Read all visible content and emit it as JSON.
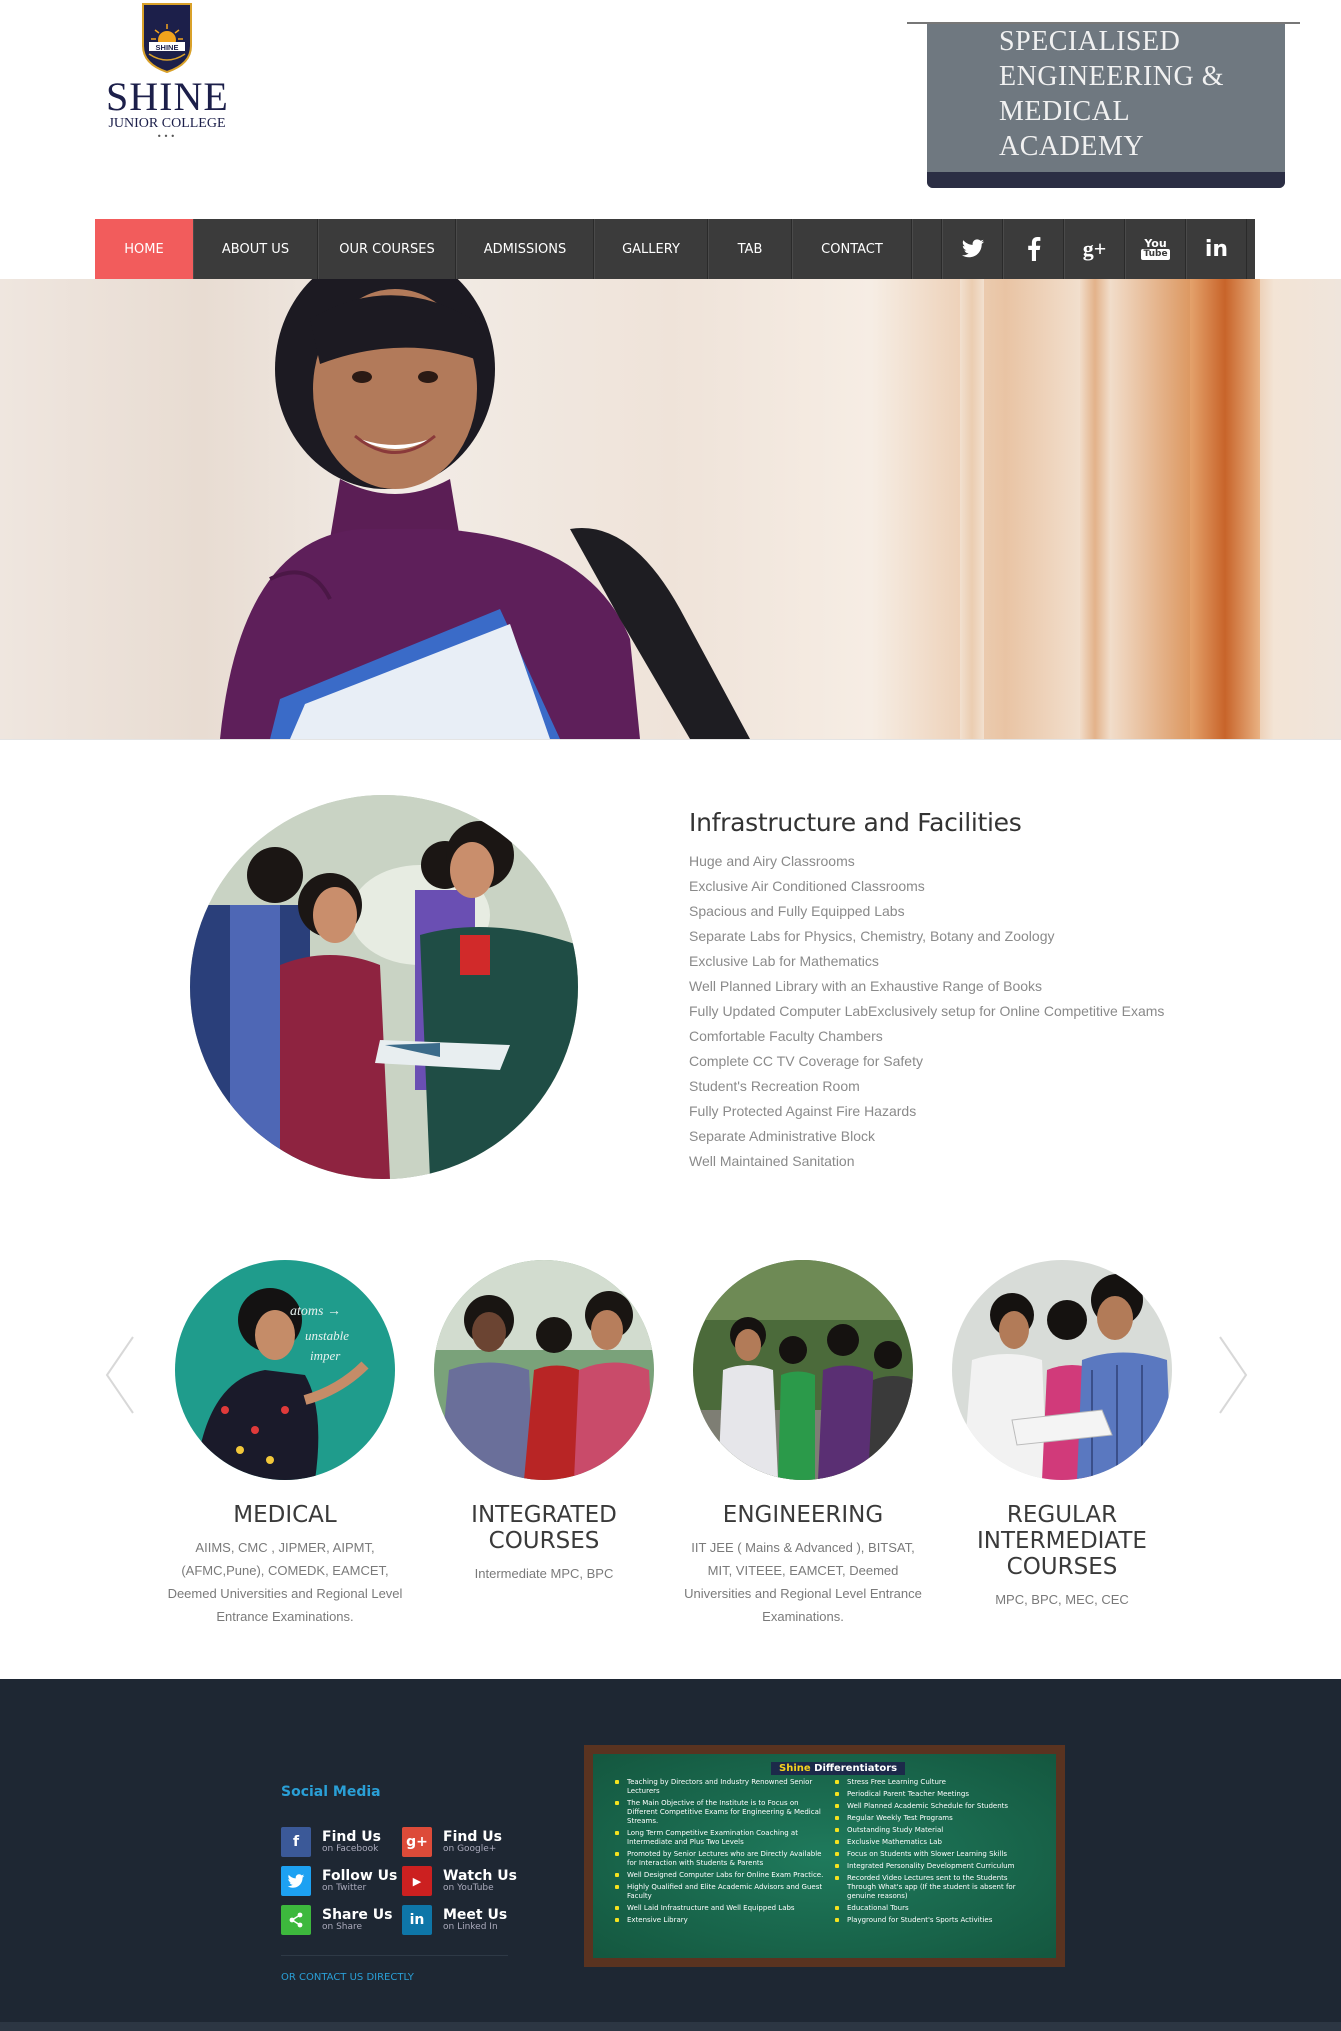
{
  "header": {
    "logo_emblem_text": "SHINE",
    "logo_title": "SHINE",
    "logo_subtitle": "JUNIOR COLLEGE",
    "logo_dots": "•••",
    "banner_lines": [
      "SPECIALISED",
      "ENGINEERING &",
      "MEDICAL",
      "ACADEMY"
    ]
  },
  "nav": {
    "items": [
      {
        "label": "HOME",
        "active": true
      },
      {
        "label": "ABOUT US"
      },
      {
        "label": "OUR COURSES"
      },
      {
        "label": "ADMISSIONS"
      },
      {
        "label": "GALLERY"
      },
      {
        "label": "TAB"
      },
      {
        "label": "CONTACT"
      }
    ],
    "social": [
      "twitter-icon",
      "facebook-icon",
      "google-plus-icon",
      "youtube-icon",
      "linkedin-icon"
    ],
    "google_plus_glyph": "g+",
    "linkedin_glyph": "in",
    "youtube_glyph_top": "You",
    "youtube_glyph_bottom": "Tube",
    "active_color": "#f25c5c"
  },
  "infra": {
    "title": "Infrastructure and Facilities",
    "items": [
      "Huge and Airy Classrooms",
      "Exclusive Air Conditioned Classrooms",
      "Spacious and Fully Equipped Labs",
      "Separate Labs for Physics, Chemistry, Botany and Zoology",
      "Exclusive Lab for Mathematics",
      "Well Planned Library with an Exhaustive Range of Books",
      "Fully Updated Computer LabExclusively setup for Online Competitive Exams",
      "Comfortable Faculty Chambers",
      "Complete CC TV Coverage for Safety",
      "Student's Recreation Room",
      "Fully Protected Against Fire Hazards",
      "Separate Administrative Block",
      "Well Maintained Sanitation"
    ]
  },
  "courses": [
    {
      "title": "MEDICAL",
      "desc": "AIIMS, CMC , JIPMER, AIPMT, (AFMC,Pune), COMEDK, EAMCET, Deemed Universities and Regional Level Entrance Examinations."
    },
    {
      "title": "INTEGRATED COURSES",
      "desc": "Intermediate MPC, BPC"
    },
    {
      "title": "ENGINEERING",
      "desc": "IIT JEE ( Mains & Advanced ), BITSAT, MIT, VITEEE, EAMCET, Deemed Universities and Regional Level Entrance Examinations."
    },
    {
      "title": "REGULAR INTERMEDIATE COURSES",
      "desc": "MPC, BPC, MEC, CEC"
    }
  ],
  "chalkboard_scribble": [
    "atoms →",
    "unstable",
    "imper"
  ],
  "footer": {
    "social_title": "Social Media",
    "social_items": [
      {
        "icon": "facebook-icon",
        "glyph": "f",
        "title": "Find Us",
        "sub": "on Facebook",
        "color": "#3b5998"
      },
      {
        "icon": "google-plus-icon",
        "glyph": "g+",
        "title": "Find Us",
        "sub": "on Google+",
        "color": "#dd4b39"
      },
      {
        "icon": "twitter-icon",
        "glyph": "t",
        "title": "Follow Us",
        "sub": "on Twitter",
        "color": "#1da1f2"
      },
      {
        "icon": "youtube-icon",
        "glyph": "▶",
        "title": "Watch Us",
        "sub": "on YouTube",
        "color": "#cc2020"
      },
      {
        "icon": "share-icon",
        "glyph": "<",
        "title": "Share Us",
        "sub": "on Share",
        "color": "#3db83d"
      },
      {
        "icon": "linkedin-icon",
        "glyph": "in",
        "title": "Meet Us",
        "sub": "on Linked In",
        "color": "#0e76a8"
      }
    ],
    "contact_link": "OR CONTACT US DIRECTLY",
    "board_title_1": "Shine",
    "board_title_2": " Differentiators",
    "board_left": [
      "Teaching by Directors and Industry Renowned Senior Lecturers",
      "The Main Objective of the Institute is to Focus on Different Competitive Exams for Engineering & Medical Streams.",
      "Long Term Competitive Examination Coaching at Intermediate and Plus Two Levels",
      "Promoted by Senior Lectures who are Directly Available for Interaction with Students & Parents",
      "Well Designed Computer Labs for Online Exam Practice.",
      "Highly Qualified and Elite Academic Advisors and Guest Faculty",
      "Well Laid Infrastructure and Well Equipped Labs",
      "Extensive Library"
    ],
    "board_right": [
      "Stress Free Learning Culture",
      "Periodical Parent Teacher Meetings",
      "Well Planned  Academic Schedule  for Students",
      "Regular Weekly Test Programs",
      "Outstanding Study Material",
      "Exclusive Mathematics Lab",
      "Focus on Students with Slower Learning Skills",
      "Integrated Personality Development Curriculum",
      "Recorded Video Lectures sent to the Students Through What's app (If the student is absent for genuine reasons)",
      "Educational Tours",
      "Playground for Student's Sports Activities"
    ]
  }
}
